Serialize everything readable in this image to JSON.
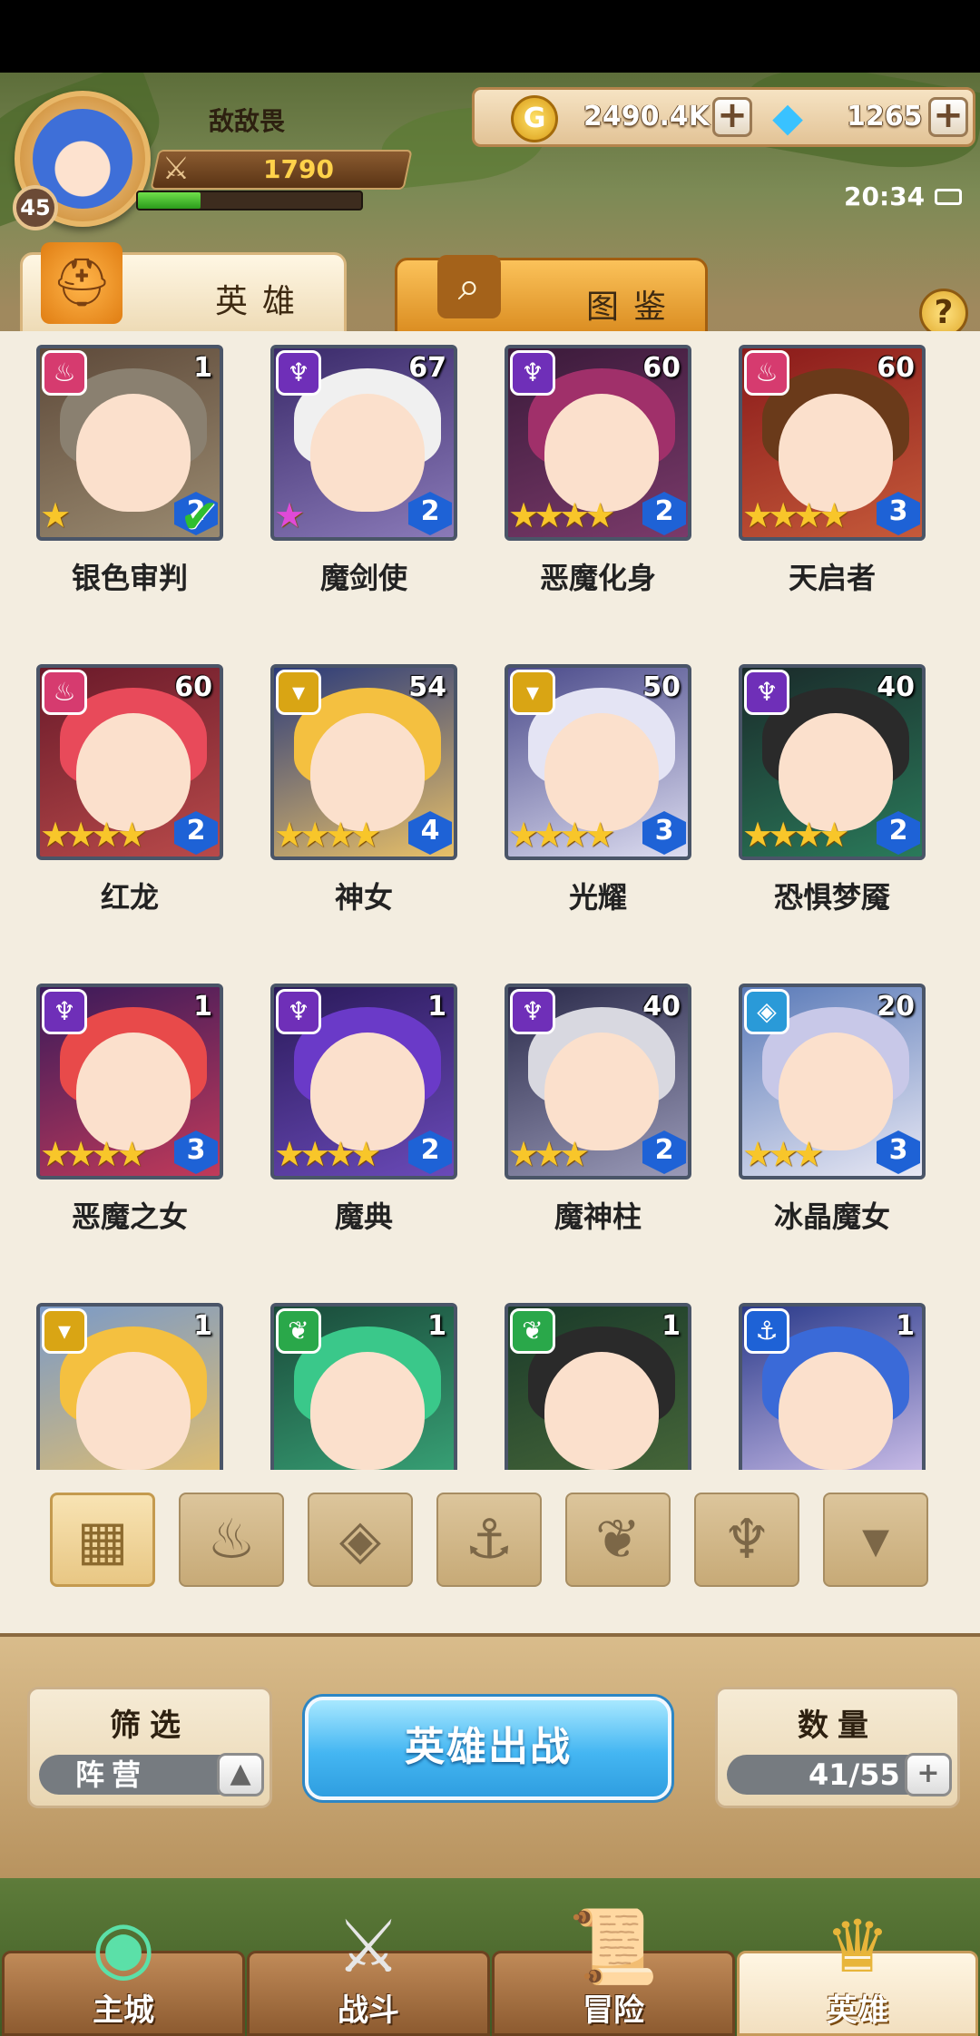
{
  "player": {
    "name": "敌敌畏",
    "level": "45",
    "power": "1790",
    "exp_fraction": 0.28
  },
  "currency": {
    "gold": "2490.4K",
    "gems": "1265"
  },
  "status": {
    "time": "20:34"
  },
  "tabs": {
    "heroes": "英雄",
    "atlas": "图鉴",
    "help": "?"
  },
  "heroes": [
    {
      "name": "银色审判",
      "level": "1",
      "rank": "2",
      "stars": 1,
      "faction": "pink",
      "selected": true
    },
    {
      "name": "魔剑使",
      "level": "67",
      "rank": "2",
      "stars": 1,
      "faction": "purple",
      "rainbow_star": true
    },
    {
      "name": "恶魔化身",
      "level": "60",
      "rank": "2",
      "stars": 4,
      "faction": "purple"
    },
    {
      "name": "天启者",
      "level": "60",
      "rank": "3",
      "stars": 4,
      "faction": "pink"
    },
    {
      "name": "红龙",
      "level": "60",
      "rank": "2",
      "stars": 4,
      "faction": "pink"
    },
    {
      "name": "神女",
      "level": "54",
      "rank": "4",
      "stars": 4,
      "faction": "gold"
    },
    {
      "name": "光耀",
      "level": "50",
      "rank": "3",
      "stars": 4,
      "faction": "gold"
    },
    {
      "name": "恐惧梦魇",
      "level": "40",
      "rank": "2",
      "stars": 4,
      "faction": "purple"
    },
    {
      "name": "恶魔之女",
      "level": "1",
      "rank": "3",
      "stars": 4,
      "faction": "purple"
    },
    {
      "name": "魔典",
      "level": "1",
      "rank": "2",
      "stars": 4,
      "faction": "purple"
    },
    {
      "name": "魔神柱",
      "level": "40",
      "rank": "2",
      "stars": 3,
      "faction": "purple"
    },
    {
      "name": "冰晶魔女",
      "level": "20",
      "rank": "3",
      "stars": 3,
      "faction": "blue"
    },
    {
      "name": "",
      "level": "1",
      "rank": "",
      "stars": 0,
      "faction": "gold"
    },
    {
      "name": "",
      "level": "1",
      "rank": "",
      "stars": 0,
      "faction": "green"
    },
    {
      "name": "",
      "level": "1",
      "rank": "",
      "stars": 0,
      "faction": "green"
    },
    {
      "name": "",
      "level": "1",
      "rank": "",
      "stars": 0,
      "faction": "anchor"
    }
  ],
  "filters": [
    "all-icon",
    "flame-icon",
    "crystal-icon",
    "anchor-icon",
    "beast-icon",
    "demon-icon",
    "holy-icon"
  ],
  "controls": {
    "filter_title": "筛选",
    "filter_value": "阵营",
    "deploy_label": "英雄出战",
    "count_title": "数量",
    "count_value": "41/55"
  },
  "nav": {
    "city": "主城",
    "battle": "战斗",
    "adventure": "冒险",
    "heroes": "英雄"
  },
  "colors": {
    "pink": "#d63b6f",
    "purple": "#6f2fb8",
    "gold": "#d9a514",
    "blue": "#2a9ad8",
    "green": "#2aa84a",
    "anchor": "#1e62d6"
  }
}
